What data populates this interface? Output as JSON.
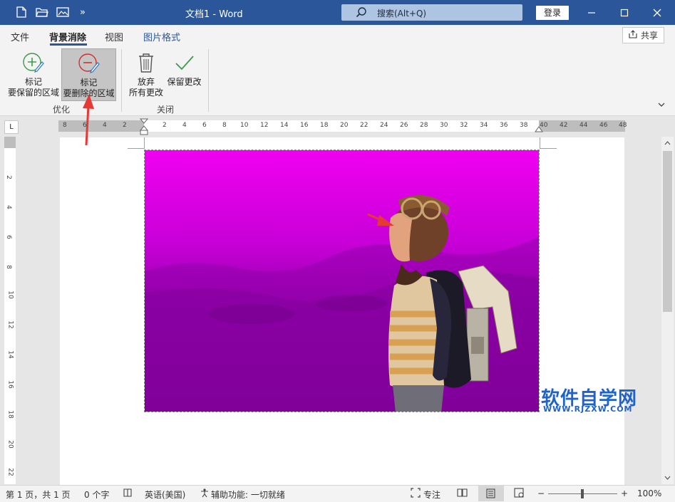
{
  "window": {
    "title": "文档1  -  Word",
    "search_placeholder": "搜索(Alt+Q)",
    "login_label": "登录",
    "qat_icons": [
      "new-doc-icon",
      "open-folder-icon",
      "picture-icon",
      "more-icon"
    ],
    "more_glyph": "»"
  },
  "menu": {
    "tabs": [
      "文件",
      "背景消除",
      "视图",
      "图片格式"
    ],
    "active_tab": "背景消除",
    "share_label": "共享"
  },
  "ribbon": {
    "mark_keep": {
      "line1": "标记",
      "line2": "要保留的区域"
    },
    "mark_remove": {
      "line1": "标记",
      "line2": "要删除的区域"
    },
    "discard": {
      "line1": "放弃",
      "line2": "所有更改"
    },
    "keep_changes": {
      "line1": "保留更改"
    },
    "group_optimize": "优化",
    "group_close": "关闭"
  },
  "ruler": {
    "corner_glyph": "L",
    "left_ticks": [
      "8",
      "6",
      "4",
      "2"
    ],
    "main_ticks": [
      "2",
      "4",
      "6",
      "8",
      "10",
      "12",
      "14",
      "16",
      "18",
      "20",
      "22",
      "24",
      "26",
      "28",
      "30",
      "32",
      "34",
      "36",
      "38",
      "40",
      "42",
      "44",
      "46",
      "48"
    ],
    "vertical_ticks": [
      "2",
      "4",
      "6",
      "8",
      "10",
      "12",
      "14",
      "16",
      "18",
      "20",
      "22"
    ]
  },
  "document": {
    "picture_label": "boy-with-toy-jetpack-background-removal-preview",
    "removal_color": "#e600e6"
  },
  "statusbar": {
    "page": "第 1 页，共 1 页",
    "words": "0 个字",
    "language": "英语(美国)",
    "accessibility": "辅助功能: 一切就绪",
    "focus": "专注",
    "zoom_minus": "−",
    "zoom_plus": "+",
    "zoom": "100%"
  },
  "watermark": {
    "main": "软件自学网",
    "sub": "WWW.RJZXW.COM"
  },
  "colors": {
    "titlebar": "#2b579a",
    "ribbon_bg": "#f3f3f3",
    "annotation_arrow": "#e53935",
    "watermark": "#1f62c9"
  }
}
